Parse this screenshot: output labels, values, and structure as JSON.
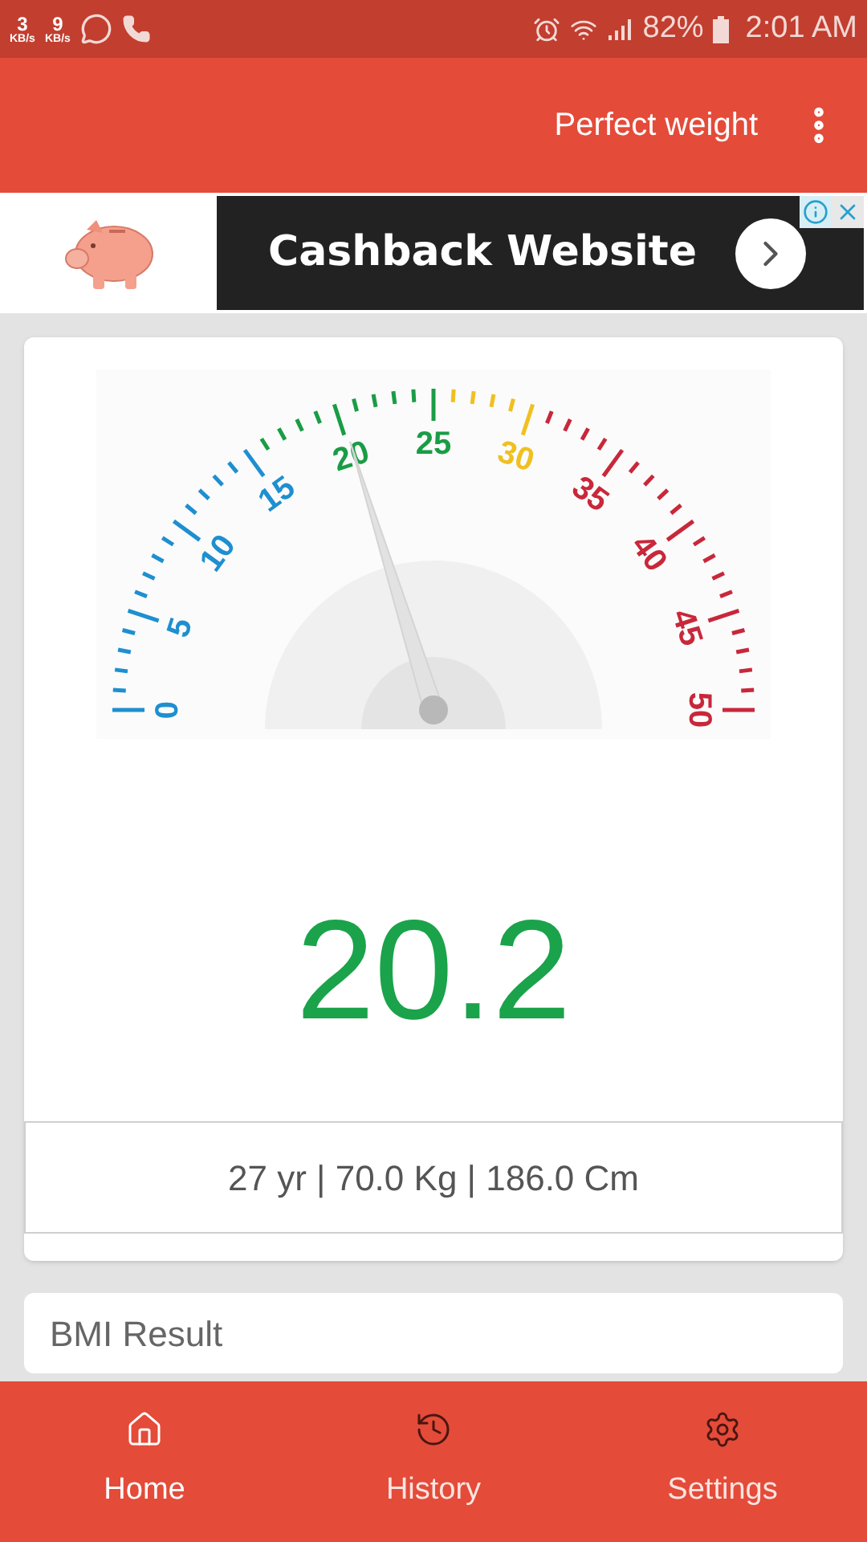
{
  "status_bar": {
    "net_speeds": [
      {
        "value": "3",
        "unit": "KB/s"
      },
      {
        "value": "9",
        "unit": "KB/s"
      }
    ],
    "battery": "82%",
    "time": "2:01 AM"
  },
  "toolbar": {
    "action": "Perfect weight"
  },
  "ad": {
    "headline": "Cashback Website"
  },
  "gauge": {
    "labels": [
      {
        "text": "0",
        "color": "#1e8fd0"
      },
      {
        "text": "5",
        "color": "#1e8fd0"
      },
      {
        "text": "10",
        "color": "#1e8fd0"
      },
      {
        "text": "15",
        "color": "#1e8fd0"
      },
      {
        "text": "20",
        "color": "#1a9c45"
      },
      {
        "text": "25",
        "color": "#1a9c45"
      },
      {
        "text": "30",
        "color": "#f0c020"
      },
      {
        "text": "35",
        "color": "#c8283a"
      },
      {
        "text": "40",
        "color": "#c8283a"
      },
      {
        "text": "45",
        "color": "#c8283a"
      },
      {
        "text": "50",
        "color": "#c8283a"
      }
    ]
  },
  "bmi_value": "20.2",
  "details": "27 yr | 70.0 Kg | 186.0 Cm",
  "result_card": {
    "title": "BMI Result"
  },
  "nav": [
    {
      "kind": "home",
      "label": "Home",
      "selected": true
    },
    {
      "kind": "history",
      "label": "History",
      "selected": false
    },
    {
      "kind": "settings",
      "label": "Settings",
      "selected": false
    }
  ]
}
